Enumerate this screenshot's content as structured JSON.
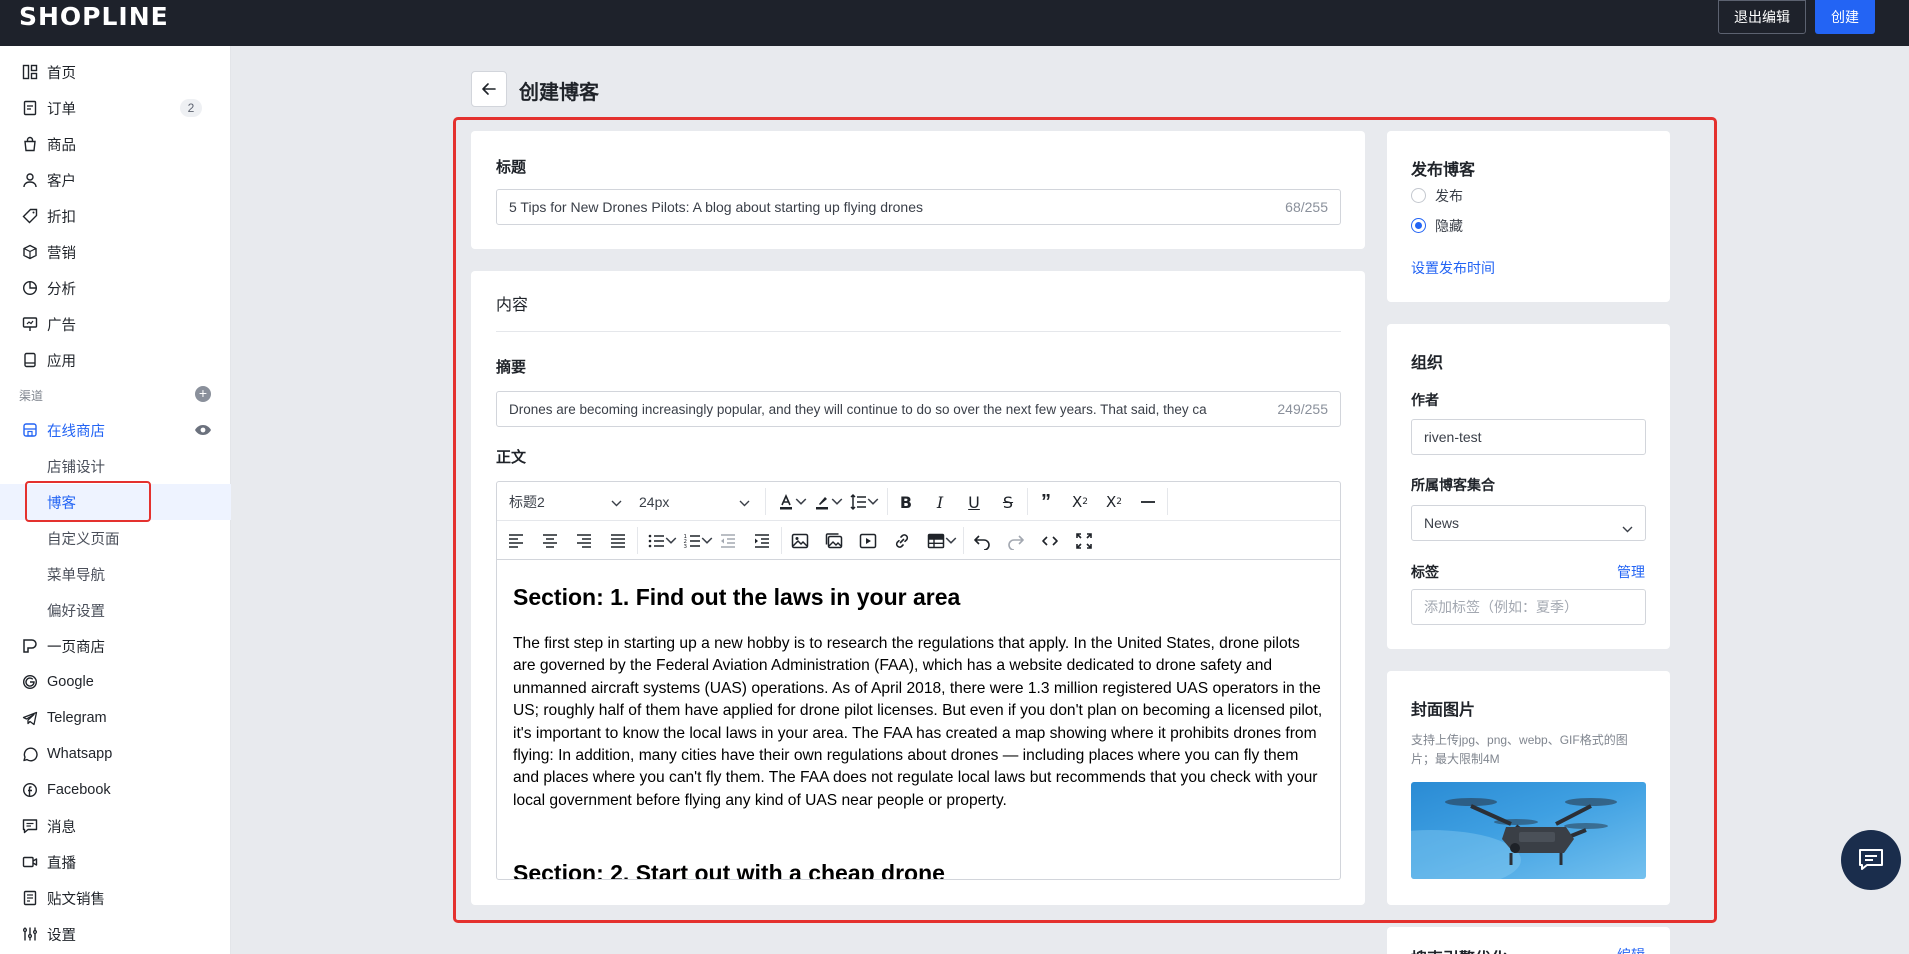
{
  "topbar": {
    "logo": "SHOPLINE",
    "exit_label": "退出编辑",
    "create_label": "创建"
  },
  "sidebar": {
    "items": [
      {
        "label": "首页",
        "icon": "home-icon"
      },
      {
        "label": "订单",
        "icon": "order-icon",
        "badge": "2"
      },
      {
        "label": "商品",
        "icon": "bag-icon"
      },
      {
        "label": "客户",
        "icon": "user-icon"
      },
      {
        "label": "折扣",
        "icon": "tag-icon"
      },
      {
        "label": "营销",
        "icon": "cube-icon"
      },
      {
        "label": "分析",
        "icon": "pie-icon"
      },
      {
        "label": "广告",
        "icon": "ad-icon"
      },
      {
        "label": "应用",
        "icon": "app-icon"
      }
    ],
    "channel_label": "渠道",
    "online_store": "在线商店",
    "sub_items": [
      "店铺设计",
      "博客",
      "自定义页面",
      "菜单导航",
      "偏好设置"
    ],
    "channels": [
      {
        "label": "一页商店",
        "icon": "one-page-icon"
      },
      {
        "label": "Google",
        "icon": "google-icon"
      },
      {
        "label": "Telegram",
        "icon": "telegram-icon"
      },
      {
        "label": "Whatsapp",
        "icon": "whatsapp-icon"
      },
      {
        "label": "Facebook",
        "icon": "facebook-icon"
      },
      {
        "label": "消息",
        "icon": "message-icon"
      },
      {
        "label": "直播",
        "icon": "live-icon"
      },
      {
        "label": "贴文销售",
        "icon": "post-icon"
      },
      {
        "label": "设置",
        "icon": "settings-icon"
      }
    ]
  },
  "header": {
    "title": "创建博客"
  },
  "title_card": {
    "label": "标题",
    "value": "5 Tips for New Drones Pilots: A blog about starting up flying drones",
    "counter": "68/255"
  },
  "content_card": {
    "label": "内容",
    "summary_label": "摘要",
    "summary_value": "Drones are becoming increasingly popular, and they will continue to do so over the next few years. That said, they ca",
    "summary_counter": "249/255",
    "body_label": "正文",
    "heading_select": "标题2",
    "size_select": "24px",
    "editor": {
      "h1": "Section: 1. Find out the laws in your area",
      "p1": "The first step in starting up a new hobby is to research the regulations that apply. In the United States, drone pilots are governed by the Federal Aviation Administration (FAA), which has a website dedicated to drone safety and unmanned aircraft systems (UAS) operations. As of April 2018, there were 1.3 million registered UAS operators in the US; roughly half of them have applied for drone pilot licenses. But even if you don't plan on becoming a licensed pilot, it's important to know the local laws in your area. The FAA has created a map showing where it prohibits drones from flying: In addition, many cities have their own regulations about drones — including places where you can fly them and places where you can't fly them. The FAA does not regulate local laws but recommends that you check with your local government before flying any kind of UAS near people or property.",
      "h2": "Section: 2. Start out with a cheap drone"
    }
  },
  "publish_card": {
    "title": "发布博客",
    "option_publish": "发布",
    "option_hide": "隐藏",
    "selected": "隐藏",
    "schedule_link": "设置发布时间"
  },
  "org_card": {
    "title": "组织",
    "author_label": "作者",
    "author_value": "riven-test",
    "collection_label": "所属博客集合",
    "collection_value": "News",
    "tags_label": "标签",
    "manage_link": "管理",
    "tags_placeholder": "添加标签（例如：夏季）"
  },
  "cover_card": {
    "title": "封面图片",
    "hint": "支持上传jpg、png、webp、GIF格式的图片；最大限制4M"
  },
  "seo_card": {
    "title": "搜索引擎优化",
    "edit_link": "编辑"
  },
  "colors": {
    "accent": "#2364f4",
    "topbar": "#1e222b",
    "highlight": "#e4312e"
  }
}
